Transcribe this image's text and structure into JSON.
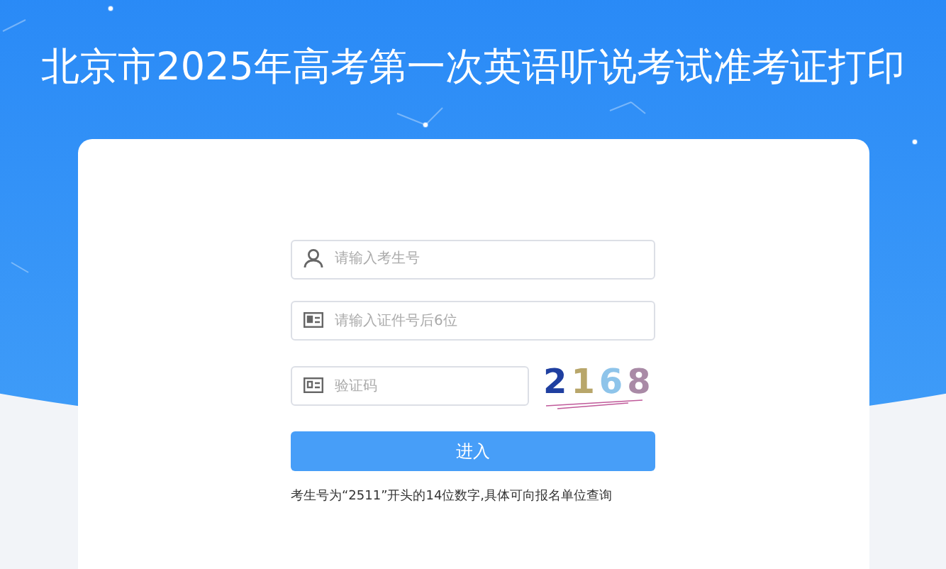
{
  "title": "北京市2025年高考第一次英语听说考试准考证打印",
  "form": {
    "fields": [
      {
        "kind": "user",
        "placeholder": "请输入考生号"
      },
      {
        "kind": "id",
        "placeholder": "请输入证件号后6位"
      },
      {
        "kind": "captcha",
        "placeholder": "验证码"
      }
    ],
    "captcha": [
      {
        "char": "2",
        "color": "#1f3fa0"
      },
      {
        "char": "1",
        "color": "#b8a66a"
      },
      {
        "char": "6",
        "color": "#8ec4ea"
      },
      {
        "char": "8",
        "color": "#a98aa6"
      }
    ],
    "submit": "进入",
    "note": "考生号为“2511”开头的14位数字,具体可向报名单位查询"
  }
}
